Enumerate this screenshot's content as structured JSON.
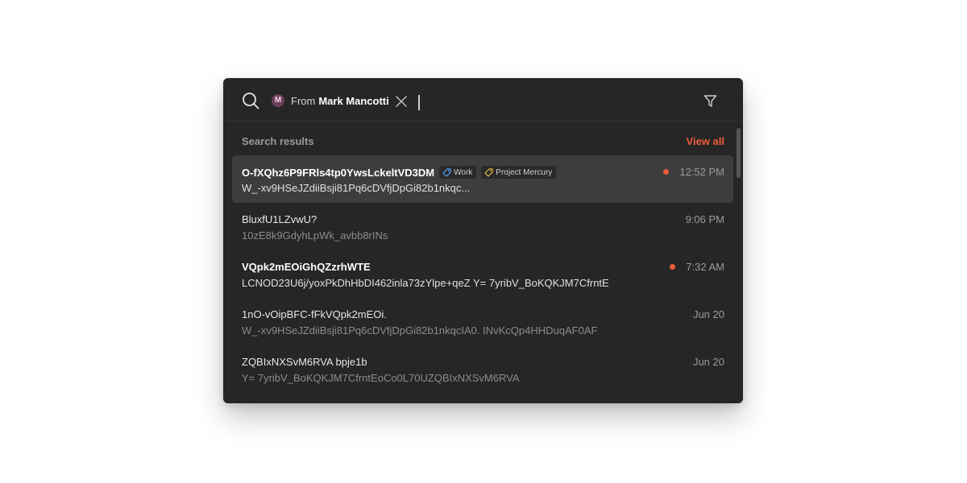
{
  "search": {
    "filter_chip": {
      "avatar_initial": "M",
      "prefix": "From",
      "name": "Mark Mancotti"
    }
  },
  "section": {
    "title": "Search results",
    "view_all_label": "View all"
  },
  "colors": {
    "accent": "#ef5b3b",
    "panel_bg": "#262626",
    "selected_row_bg": "#3d3d3d",
    "work_tag_icon": "#5aa0ff",
    "mercury_tag_icon": "#e6b93a"
  },
  "results": [
    {
      "subject": "O-fXQhz6P9FRls4tp0YwsLckeltVD3DM",
      "preview": "W_-xv9HSeJZdiiBsji81Pq6cDVfjDpGi82b1nkqc...",
      "time": "12:52 PM",
      "tags": [
        {
          "label": "Work",
          "icon": "tag-icon"
        },
        {
          "label": "Project Mercury",
          "icon": "tag-icon"
        }
      ]
    },
    {
      "subject": "BluxfU1LZvwU?",
      "preview": "10zE8k9GdyhLpWk_avbb8rINs",
      "time": "9:06 PM"
    },
    {
      "subject": "VQpk2mEOiGhQZzrhWTE",
      "preview": "LCNOD23U6j/yoxPkDhHbDI462inla73zYlpe+qeZ Y= 7yribV_BoKQKJM7CfrntE",
      "time": "7:32 AM"
    },
    {
      "subject": "1nO-vOipBFC-fFkVQpk2mEOi.",
      "preview": "W_-xv9HSeJZdiiBsji81Pq6cDVfjDpGi82b1nkqcIA0. INvKcQp4HHDuqAF0AF",
      "time": "Jun 20"
    },
    {
      "subject": "ZQBIxNXSvM6RVA bpje1b",
      "preview": "Y= 7yribV_BoKQKJM7CfrntEoCo0L70UZQBIxNXSvM6RVA",
      "time": "Jun 20"
    }
  ]
}
